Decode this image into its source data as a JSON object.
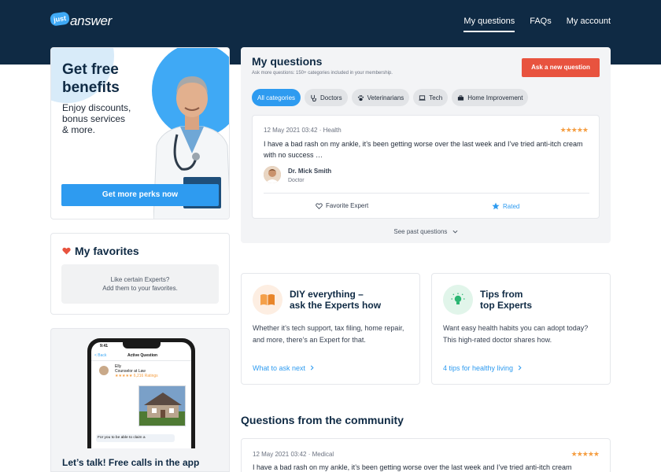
{
  "header": {
    "logo_badge": "just",
    "logo_text": "answer",
    "nav": [
      "My questions",
      "FAQs",
      "My account"
    ]
  },
  "promo": {
    "title_line1": "Get free",
    "title_line2": "benefits",
    "subtitle_line1": "Enjoy discounts,",
    "subtitle_line2": "bonus services",
    "subtitle_line3": "& more.",
    "button": "Get more perks now"
  },
  "favorites": {
    "title": "My favorites",
    "empty_line1": "Like certain Experts?",
    "empty_line2": "Add them to your favorites."
  },
  "app": {
    "time": "9:41",
    "back": "< Back",
    "active": "Active Question",
    "expert_name": "Elly",
    "expert_role": "Counselor at Law",
    "ratings": "★★★★★ 6,216 Ratings",
    "msg": "For you to be able to claim a",
    "title": "Let’s talk! Free calls in the app"
  },
  "questions": {
    "title": "My questions",
    "subtitle": "Ask more questions: 150+ categories included in your membership.",
    "ask_button": "Ask a new question",
    "categories": [
      "All categories",
      "Doctors",
      "Veterinarians",
      "Tech",
      "Home Improvement"
    ],
    "card": {
      "meta": "12 May 2021 03:42 · Health",
      "stars": "★★★★★",
      "text": "I have a bad rash on my ankle, it’s been getting worse over the last week and I’ve tried anti-itch cream with no success …",
      "expert_name": "Dr. Mick Smith",
      "expert_role": "Doctor",
      "favorite": "Favorite Expert",
      "rated": "Rated"
    },
    "see_past": "See past questions"
  },
  "info": [
    {
      "title_line1": "DIY everything –",
      "title_line2": "ask the Experts how",
      "text": "Whether it’s tech support, tax filing, home repair, and more, there’s an Expert for that.",
      "link": "What to ask next"
    },
    {
      "title_line1": "Tips from",
      "title_line2": "top Experts",
      "text": "Want easy health habits you can adopt today? This high-rated doctor shares how.",
      "link": "4 tips for healthy living"
    }
  ],
  "community": {
    "title": "Questions from the community",
    "meta": "12 May 2021 03:42 · Medical",
    "stars": "★★★★★",
    "text": "I have a bad rash on my ankle, it’s been getting worse over the last week and I’ve tried anti-itch cream"
  },
  "colors": {
    "header_bg": "#0f2a44",
    "primary_blue": "#2e9bf0",
    "cta_orange": "#e8533f",
    "star": "#f59e42"
  }
}
